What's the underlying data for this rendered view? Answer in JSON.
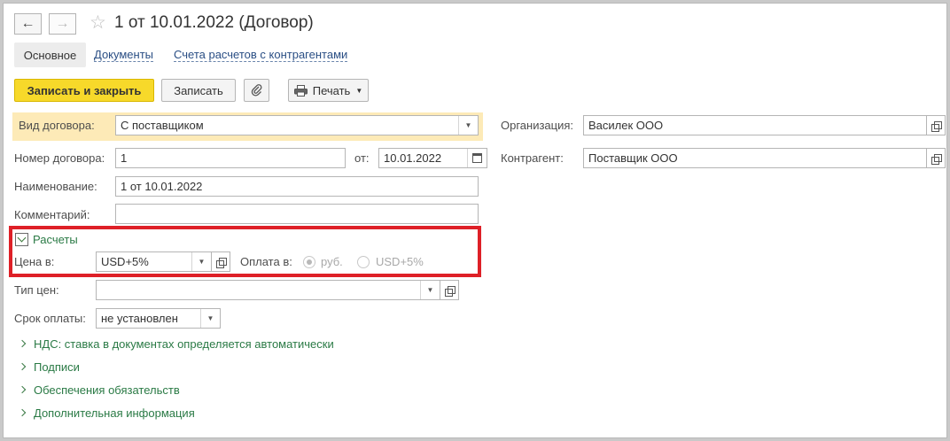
{
  "header": {
    "title": "1 от 10.01.2022 (Договор)",
    "back_icon": "←",
    "forward_icon": "→",
    "star_icon": "☆"
  },
  "tabs": {
    "main": "Основное",
    "documents": "Документы",
    "accounts": "Счета расчетов с контрагентами"
  },
  "toolbar": {
    "save_close": "Записать и закрыть",
    "save": "Записать",
    "print": "Печать",
    "attach_icon": "paperclip-icon",
    "print_icon": "printer-icon",
    "primary_color": "#f7d92a"
  },
  "form": {
    "contract_type_label": "Вид договора:",
    "contract_type_value": "С поставщиком",
    "number_label": "Номер договора:",
    "number_value": "1",
    "date_label": "от:",
    "date_value": "10.01.2022",
    "name_label": "Наименование:",
    "name_value": "1 от 10.01.2022",
    "comment_label": "Комментарий:",
    "comment_value": "",
    "organization_label": "Организация:",
    "organization_value": "Василек ООО",
    "counterparty_label": "Контрагент:",
    "counterparty_value": "Поставщик ООО"
  },
  "settlements": {
    "group_label": "Расчеты",
    "price_in_label": "Цена в:",
    "price_in_value": "USD+5%",
    "payment_in_label": "Оплата в:",
    "payment_options": [
      "руб.",
      "USD+5%"
    ],
    "payment_selected": "руб.",
    "highlight_color": "#de2027"
  },
  "price_type": {
    "label": "Тип цен:",
    "value": ""
  },
  "payment_term": {
    "label": "Срок оплаты:",
    "value": "не установлен"
  },
  "groups": [
    "НДС: ставка в документах определяется автоматически",
    "Подписи",
    "Обеспечения обязательств",
    "Дополнительная информация"
  ]
}
